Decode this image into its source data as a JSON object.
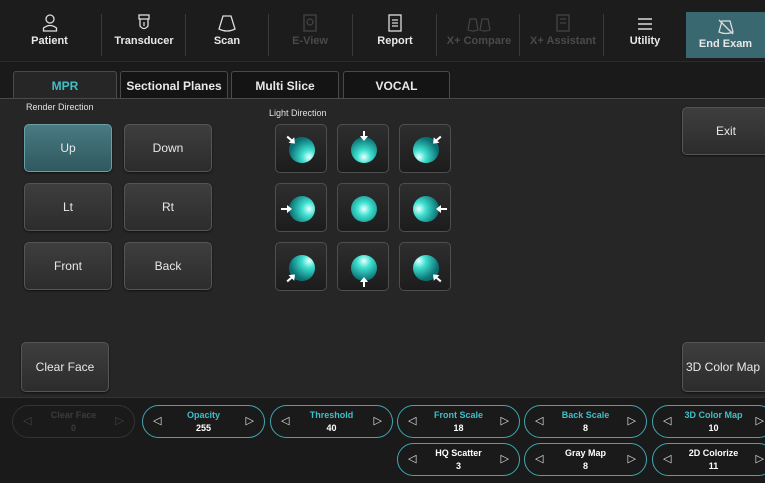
{
  "topbar": {
    "items": [
      {
        "label": "Patient",
        "icon": "patient-icon",
        "enabled": true
      },
      {
        "label": "Transducer",
        "icon": "transducer-icon",
        "enabled": true
      },
      {
        "label": "Scan",
        "icon": "scan-icon",
        "enabled": true
      },
      {
        "label": "E-View",
        "icon": "eview-icon",
        "enabled": false
      },
      {
        "label": "Report",
        "icon": "report-icon",
        "enabled": true
      },
      {
        "label": "X+ Compare",
        "icon": "compare-icon",
        "enabled": false
      },
      {
        "label": "X+ Assistant",
        "icon": "assistant-icon",
        "enabled": false
      },
      {
        "label": "Utility",
        "icon": "utility-icon",
        "enabled": true
      }
    ],
    "end_exam": {
      "label": "End Exam",
      "icon": "end-exam-icon"
    }
  },
  "tabs": [
    {
      "label": "MPR",
      "active": true
    },
    {
      "label": "Sectional Planes",
      "active": false
    },
    {
      "label": "Multi Slice",
      "active": false
    },
    {
      "label": "VOCAL",
      "active": false
    }
  ],
  "render_direction": {
    "label": "Render Direction",
    "buttons": {
      "up": "Up",
      "down": "Down",
      "lt": "Lt",
      "rt": "Rt",
      "front": "Front",
      "back": "Back"
    },
    "selected": "Up"
  },
  "light_direction": {
    "label": "Light Direction",
    "buttons": [
      "top-left",
      "top",
      "top-right",
      "left",
      "center",
      "right",
      "bottom-left",
      "bottom",
      "bottom-right"
    ]
  },
  "actions": {
    "exit": "Exit",
    "clear_face": "Clear Face",
    "color_map_3d": "3D Color Map"
  },
  "knobs_row1": [
    {
      "name": "Clear Face",
      "value": "0",
      "enabled": false
    },
    {
      "name": "Opacity",
      "value": "255",
      "enabled": true
    },
    {
      "name": "Threshold",
      "value": "40",
      "enabled": true
    },
    {
      "name": "Front Scale",
      "value": "18",
      "enabled": true
    },
    {
      "name": "Back Scale",
      "value": "8",
      "enabled": true
    },
    {
      "name": "3D Color Map",
      "value": "10",
      "enabled": true
    }
  ],
  "knobs_row2": [
    {
      "name": "HQ Scatter",
      "value": "3",
      "enabled": true
    },
    {
      "name": "Gray Map",
      "value": "8",
      "enabled": true
    },
    {
      "name": "2D Colorize",
      "value": "11",
      "enabled": true
    }
  ],
  "colors": {
    "accent": "#3fbfc8",
    "end_exam_bg": "#3a6870",
    "selected_btn": "#3d6e76"
  }
}
